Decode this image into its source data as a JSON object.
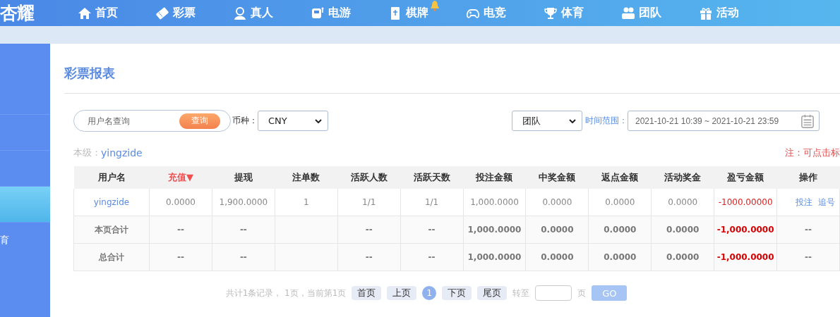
{
  "header": {
    "logo": "杏耀",
    "nav": [
      {
        "label": "首页",
        "selected": false,
        "badge": false
      },
      {
        "label": "彩票",
        "selected": false,
        "badge": false
      },
      {
        "label": "真人",
        "selected": false,
        "badge": false
      },
      {
        "label": "电游",
        "selected": false,
        "badge": false
      },
      {
        "label": "棋牌",
        "selected": false,
        "badge": true
      },
      {
        "label": "电竞",
        "selected": false,
        "badge": false
      },
      {
        "label": "体育",
        "selected": false,
        "badge": false
      },
      {
        "label": "团队",
        "selected": false,
        "badge": false
      },
      {
        "label": "活动",
        "selected": false,
        "badge": false
      }
    ]
  },
  "sidebar": {
    "items": [
      {
        "selected": false
      },
      {
        "selected": false
      },
      {
        "selected": false
      },
      {
        "selected": true
      },
      {
        "label": "育",
        "selected": false
      }
    ]
  },
  "page": {
    "title": "彩票报表",
    "filters": {
      "search": {
        "placeholder": "用户名查询",
        "button": "查询"
      },
      "currency": {
        "label": "币种：",
        "value": "CNY"
      },
      "scope": {
        "value": "团队"
      },
      "time": {
        "label": "时间范围：",
        "value": "2021-10-21 10:39 ~ 2021-10-21 23:59"
      }
    },
    "level": {
      "label": "本级：",
      "user": "yingzide"
    },
    "note": "注：可点击标",
    "table": {
      "columns": [
        {
          "label": "用户名",
          "sorted": false
        },
        {
          "label": "充值▼",
          "sorted": true
        },
        {
          "label": "提现",
          "sorted": false
        },
        {
          "label": "注单数",
          "sorted": false
        },
        {
          "label": "活跃人数",
          "sorted": false
        },
        {
          "label": "活跃天数",
          "sorted": false
        },
        {
          "label": "投注金额",
          "sorted": false
        },
        {
          "label": "中奖金额",
          "sorted": false
        },
        {
          "label": "返点金额",
          "sorted": false
        },
        {
          "label": "活动奖金",
          "sorted": false
        },
        {
          "label": "盈亏金额",
          "sorted": false
        },
        {
          "label": "操作",
          "sorted": false
        }
      ],
      "rows": [
        {
          "kind": "data",
          "cells": [
            "yingzide",
            "0.0000",
            "1,900.0000",
            "1",
            "1/1",
            "1/1",
            "1,000.0000",
            "0.0000",
            "0.0000",
            "0.0000",
            "-1000.00000"
          ],
          "actions": [
            "投注",
            "追号"
          ]
        },
        {
          "kind": "total",
          "cells": [
            "本页合计",
            "--",
            "--",
            "",
            "--",
            "--",
            "1,000.0000",
            "0.0000",
            "0.0000",
            "0.0000",
            "-1,000.0000",
            "--"
          ]
        },
        {
          "kind": "total",
          "cells": [
            "总合计",
            "--",
            "--",
            "",
            "--",
            "--",
            "1,000.0000",
            "0.0000",
            "0.0000",
            "0.0000",
            "-1,000.0000",
            "--"
          ]
        }
      ]
    },
    "pagination": {
      "summary": "共计1条记录，  1页，当前第1页",
      "buttons": [
        "首页",
        "上页"
      ],
      "pages": [
        {
          "label": "1",
          "selected": true
        }
      ],
      "buttons_after": [
        "下页",
        "尾页"
      ],
      "goto_label": "转至",
      "goto_unit": "页",
      "go": "GO"
    }
  }
}
